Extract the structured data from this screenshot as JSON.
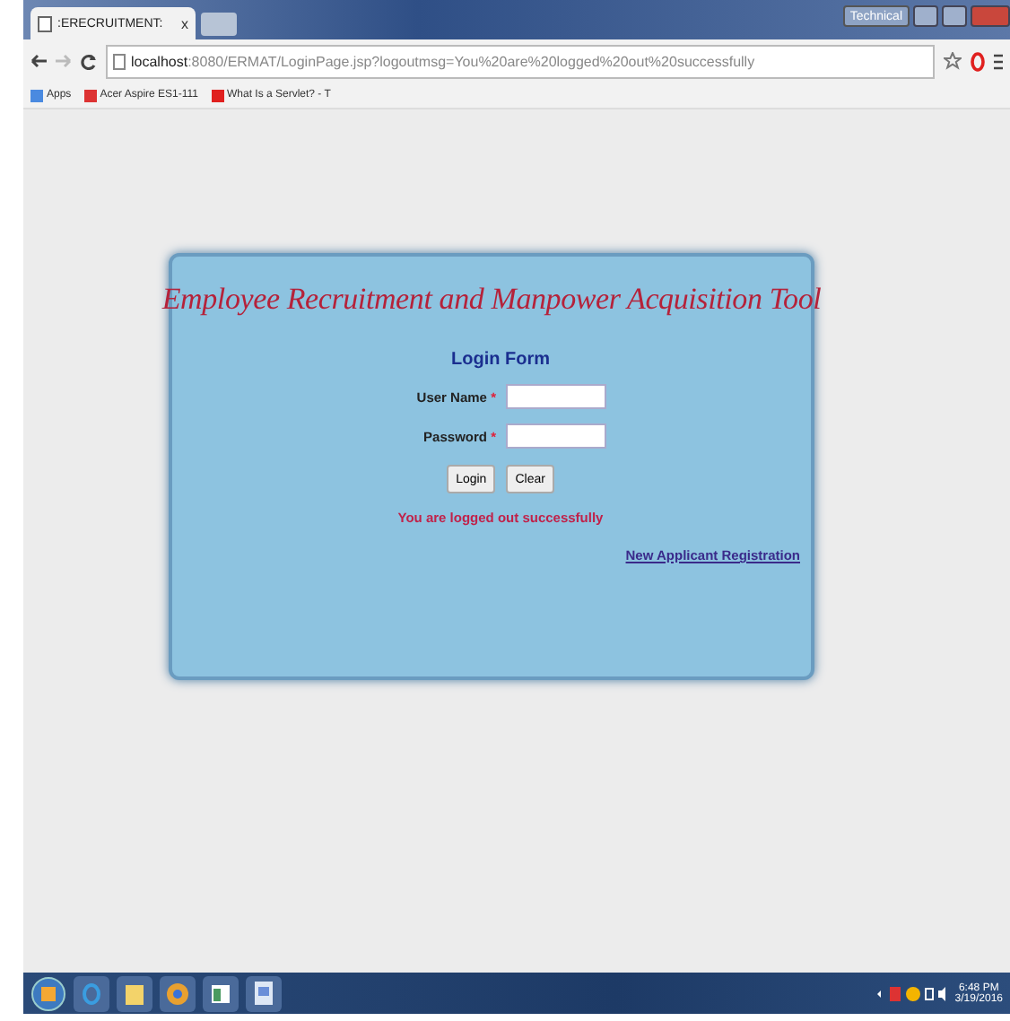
{
  "browser": {
    "tab_title": ":ERECRUITMENT:",
    "tab_close": "x",
    "profile_button": "Technical",
    "url_host": "localhost",
    "url_rest": ":8080/ERMAT/LoginPage.jsp?logoutmsg=You%20are%20logged%20out%20successfully",
    "bookmarks": [
      "Apps",
      "Acer Aspire ES1-111",
      "What Is a Servlet? - T"
    ]
  },
  "page": {
    "title": "Employee Recruitment and Manpower Acquisition Tool",
    "form_title": "Login Form",
    "fields": [
      {
        "label": "User Name",
        "required_mark": "*"
      },
      {
        "label": "Password",
        "required_mark": "*"
      }
    ],
    "buttons": [
      "Login",
      "Clear"
    ],
    "message": "You are logged out successfully",
    "link": "New Applicant Registration"
  },
  "taskbar": {
    "time": "6:48 PM",
    "date": "3/19/2016"
  }
}
